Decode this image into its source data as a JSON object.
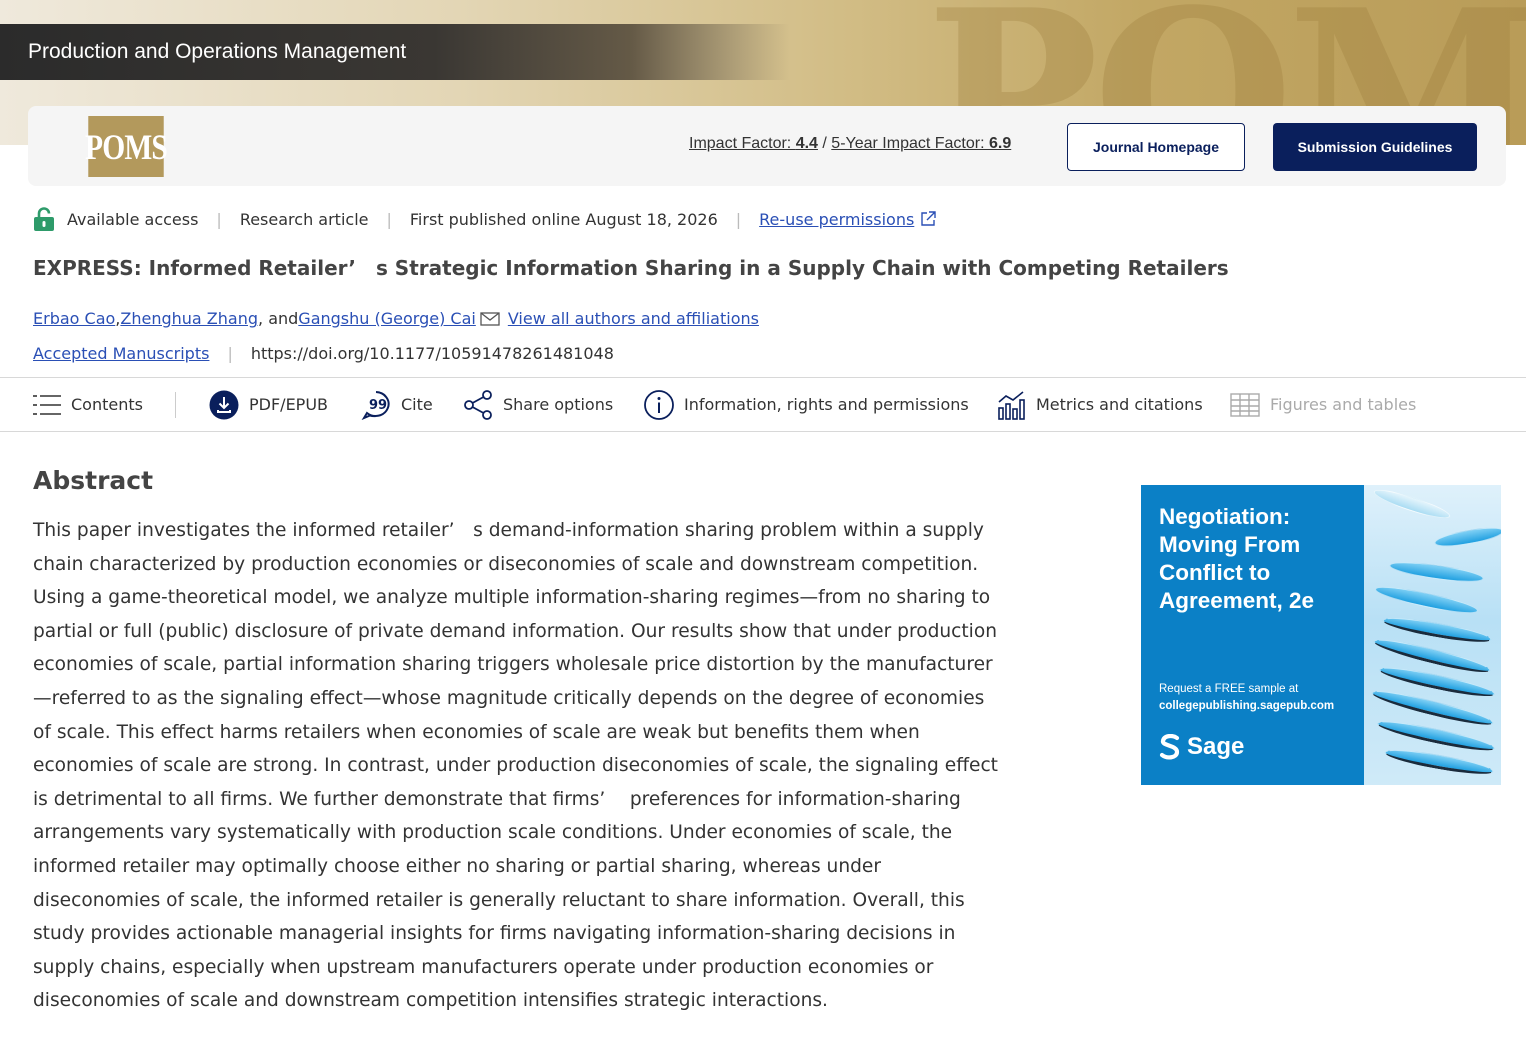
{
  "journal": {
    "name": "Production and Operations Management",
    "logo_text": "POMS",
    "banner_letters": "POM"
  },
  "header": {
    "impact_factor_label": "Impact Factor: ",
    "impact_factor_value": "4.4",
    "impact_sep": " / ",
    "five_year_label": "5-Year Impact Factor: ",
    "five_year_value": "6.9",
    "journal_homepage_label": "Journal Homepage",
    "submission_guidelines_label": "Submission Guidelines"
  },
  "meta": {
    "access": "Available access",
    "type": "Research article",
    "published": "First published online August 18, 2026",
    "reuse": "Re-use permissions",
    "separator": "|"
  },
  "article": {
    "title": "EXPRESS: Informed Retailer’ s Strategic Information Sharing in a Supply Chain with Competing Retailers",
    "authors": [
      {
        "name": "Erbao Cao"
      },
      {
        "name": "Zhenghua Zhang"
      },
      {
        "name": "Gangshu (George) Cai"
      }
    ],
    "author_sep_1": ", ",
    "author_sep_2": ", and ",
    "view_all": "View all authors and affiliations",
    "accepted": "Accepted Manuscripts",
    "doi": "https://doi.org/10.1177/10591478261481048"
  },
  "toolbar": {
    "contents": "Contents",
    "pdf": "PDF/EPUB",
    "cite": "Cite",
    "share": "Share options",
    "info": "Information, rights and permissions",
    "metrics": "Metrics and citations",
    "figures": "Figures and tables"
  },
  "abstract": {
    "heading": "Abstract",
    "body": "This paper investigates the informed retailer’ s demand-information sharing problem within a supply chain characterized by production economies or diseconomies of scale and downstream competition. Using a game-theoretical model, we analyze multiple information-sharing regimes—from no sharing to partial or full (public) disclosure of private demand information. Our results show that under production economies of scale, partial information sharing triggers wholesale price distortion by the manufacturer—referred to as the signaling effect—whose magnitude critically depends on the degree of economies of scale. This effect harms retailers when economies of scale are weak but benefits them when economies of scale are strong. In contrast, under production diseconomies of scale, the signaling effect is detrimental to all firms. We further demonstrate that firms’  preferences for information-sharing arrangements vary systematically with production scale conditions. Under economies of scale, the informed retailer may optimally choose either no sharing or partial sharing, whereas under diseconomies of scale, the informed retailer is generally reluctant to share information. Overall, this study provides actionable managerial insights for firms navigating information-sharing decisions in supply chains, especially when upstream manufacturers operate under production economies or diseconomies of scale and downstream competition intensifies strategic interactions."
  },
  "ad": {
    "title": "Negotiation: Moving From Conflict to Agreement, 2e",
    "cta_line1": "Request a FREE sample at",
    "cta_line2": "collegepublishing.sagepub.com",
    "brand": "Sage"
  },
  "colors": {
    "navy": "#0a1f5c",
    "link": "#2a4fb5",
    "gold": "#b3995c",
    "access_green": "#2e9b6a",
    "ad_blue": "#0b80c6"
  }
}
